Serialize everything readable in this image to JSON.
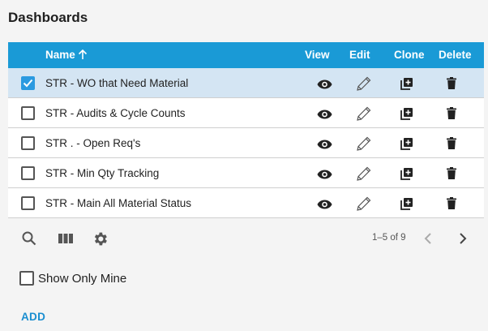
{
  "page_title": "Dashboards",
  "table": {
    "columns": {
      "name": "Name",
      "view": "View",
      "edit": "Edit",
      "clone": "Clone",
      "delete": "Delete"
    },
    "sort_indicator": "arrow-up-icon",
    "rows": [
      {
        "name": "STR - WO that Need Material",
        "selected": true
      },
      {
        "name": "STR - Audits & Cycle Counts",
        "selected": false
      },
      {
        "name": "STR . - Open Req's",
        "selected": false
      },
      {
        "name": "STR - Min Qty Tracking",
        "selected": false
      },
      {
        "name": "STR - Main All Material Status",
        "selected": false
      }
    ]
  },
  "footer": {
    "icons": [
      "search-icon",
      "columns-icon",
      "gear-icon"
    ],
    "pager_text": "1–5 of 9"
  },
  "show_only_mine": {
    "label": "Show Only Mine",
    "checked": false
  },
  "add_label": "ADD",
  "colors": {
    "header_bg": "#1a9ad6",
    "selected_row_bg": "#d4e5f3",
    "checkbox_checked": "#2b9ae0",
    "link": "#1a8ed0"
  }
}
